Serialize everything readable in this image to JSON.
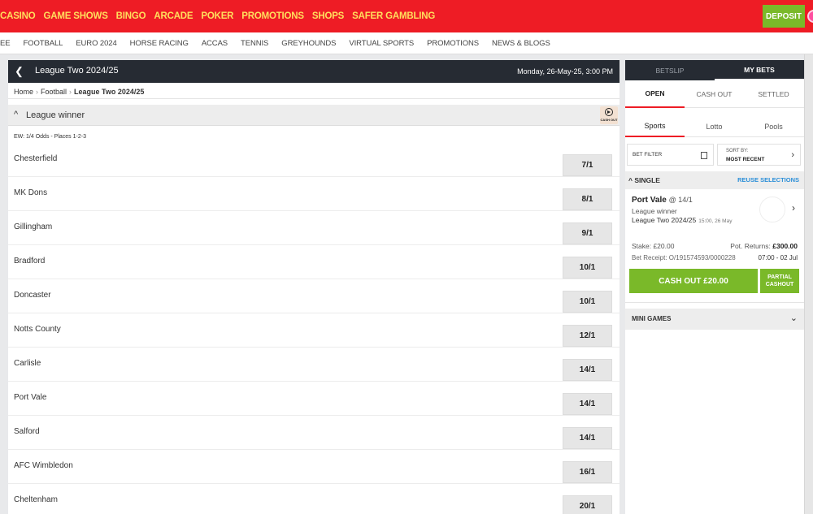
{
  "topnav": {
    "items": [
      "CASINO",
      "GAME SHOWS",
      "BINGO",
      "ARCADE",
      "POKER",
      "PROMOTIONS",
      "SHOPS",
      "SAFER GAMBLING"
    ],
    "deposit_label": "DEPOSIT"
  },
  "subnav": {
    "items": [
      "EE",
      "FOOTBALL",
      "EURO 2024",
      "HORSE RACING",
      "ACCAS",
      "TENNIS",
      "GREYHOUNDS",
      "VIRTUAL SPORTS",
      "PROMOTIONS",
      "NEWS & BLOGS"
    ]
  },
  "event": {
    "title": "League Two 2024/25",
    "date": "Monday, 26-May-25, 3:00 PM",
    "breadcrumb": [
      "Home",
      "Football",
      "League Two 2024/25"
    ]
  },
  "market": {
    "title": "League winner",
    "cashout_badge": "CASH OUT",
    "each_way": "EW: 1/4 Odds - Places 1-2-3",
    "selections": [
      {
        "team": "Chesterfield",
        "odds": "7/1"
      },
      {
        "team": "MK Dons",
        "odds": "8/1"
      },
      {
        "team": "Gillingham",
        "odds": "9/1"
      },
      {
        "team": "Bradford",
        "odds": "10/1"
      },
      {
        "team": "Doncaster",
        "odds": "10/1"
      },
      {
        "team": "Notts County",
        "odds": "12/1"
      },
      {
        "team": "Carlisle",
        "odds": "14/1"
      },
      {
        "team": "Port Vale",
        "odds": "14/1"
      },
      {
        "team": "Salford",
        "odds": "14/1"
      },
      {
        "team": "AFC Wimbledon",
        "odds": "16/1"
      },
      {
        "team": "Cheltenham",
        "odds": "20/1"
      }
    ]
  },
  "betslip": {
    "tabs": [
      "BETSLIP",
      "MY BETS"
    ],
    "status_tabs": [
      "OPEN",
      "CASH OUT",
      "SETTLED"
    ],
    "product_tabs": [
      "Sports",
      "Lotto",
      "Pools"
    ],
    "bet_filter": "BET FILTER",
    "sort_label": "SORT BY:",
    "sort_value": "MOST RECENT",
    "single_label": "SINGLE",
    "reuse_label": "REUSE SELECTIONS",
    "bet": {
      "selection": "Port Vale",
      "price": "@ 14/1",
      "market": "League winner",
      "event": "League Two 2024/25",
      "event_time": "15:00, 26 May",
      "stake": "Stake: £20.00",
      "pot_label": "Pot. Returns:",
      "pot_value": "£300.00",
      "receipt": "Bet Receipt: O/191574593/0000228",
      "receipt_time": "07:00 - 02 Jul",
      "cashout_label": "CASH OUT £20.00",
      "partial_line1": "PARTIAL",
      "partial_line2": "CASHOUT"
    },
    "mini_games": "MINI GAMES"
  },
  "colors": {
    "brand_red": "#ee1c25",
    "nav_yellow": "#ffdf5d",
    "green": "#7ab929",
    "dark_header": "#262b33",
    "link_blue": "#2c8fd8"
  }
}
